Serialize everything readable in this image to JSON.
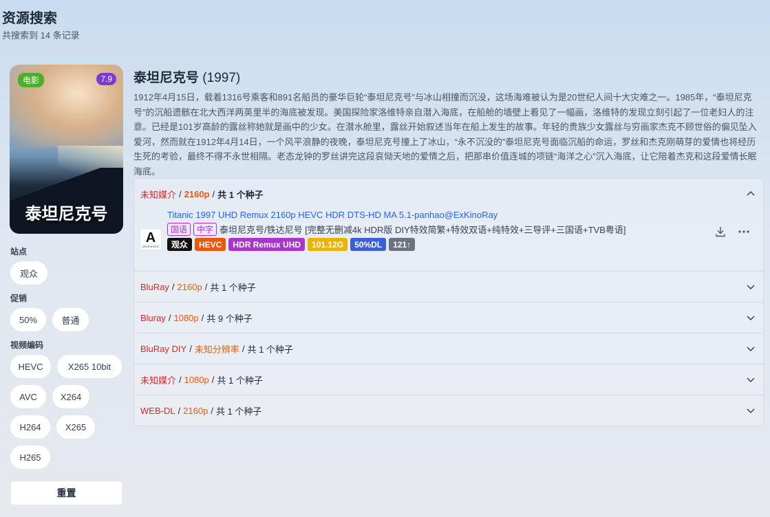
{
  "page": {
    "title": "资源搜索",
    "subtitle": "共搜索到 14 条记录"
  },
  "movie": {
    "poster_text": "泰坦尼克号",
    "type_badge": "电影",
    "rating_badge": "7.9",
    "title": "泰坦尼克号",
    "year": "(1997)",
    "overview": "1912年4月15日，载着1316号乘客和891名船员的豪华巨轮“泰坦尼克号”与冰山相撞而沉没，这场海难被认为是20世纪人间十大灾难之一。1985年，“泰坦尼克号”的沉船遗骸在北大西洋两英里半的海底被发现。美国探险家洛维特亲自潜入海底，在船舱的墙壁上看见了一幅画，洛维特的发现立刻引起了一位老妇人的注意。已经是101岁高龄的露丝称她就是画中的少女。在潜水舱里，露丝开始叙述当年在船上发生的故事。年轻的贵族少女露丝与穷画家杰克不顾世俗的偏见坠入爱河，然而就在1912年4月14日，一个风平浪静的夜晚，泰坦尼克号撞上了冰山，“永不沉没的”泰坦尼克号面临沉船的命运，罗丝和杰克刚萌芽的爱情也将经历生死的考验，最终不得不永世相隔。老态龙钟的罗丝讲完这段哀恸天地的爱情之后，把那串价值连城的项链“海洋之心”沉入海底，让它陪着杰克和这段爱情长眠海底。"
  },
  "filters": {
    "site_label": "站点",
    "sites": [
      "观众"
    ],
    "promo_label": "促销",
    "promos": [
      "50%",
      "普通"
    ],
    "codec_label": "视频编码",
    "codecs": [
      "HEVC",
      "X265 10bit",
      "AVC",
      "X264",
      "H264",
      "X265",
      "H265"
    ],
    "reset": "重置"
  },
  "groups": [
    {
      "source": "未知媒介",
      "res": "2160p",
      "count": "共 1 个种子",
      "expanded": true
    },
    {
      "source": "BluRay",
      "res": "2160p",
      "count": "共 1 个种子"
    },
    {
      "source": "Bluray",
      "res": "1080p",
      "count": "共 9 个种子"
    },
    {
      "source": "BluRay DIY",
      "res": "未知分辨率",
      "count": "共 1 个种子"
    },
    {
      "source": "未知媒介",
      "res": "1080p",
      "count": "共 1 个种子"
    },
    {
      "source": "WEB-DL",
      "res": "2160p",
      "count": "共 1 个种子"
    }
  ],
  "separator": "/",
  "torrent": {
    "logo_big": "A",
    "logo_small": "UDIENCES",
    "name": "Titanic 1997 UHD Remux 2160p HEVC HDR DTS-HD MA 5.1-panhao@ExKinoRay",
    "lang_tags": [
      "国语",
      "中字"
    ],
    "desc": "泰坦尼克号/铁达尼号 [完整无删减4k HDR版 DIY特效简繁+特效双语+纯特效+三导评+三国语+TVB粤语]",
    "tags": [
      {
        "text": "观众",
        "color": "#111111"
      },
      {
        "text": "HEVC",
        "color": "#ea580c"
      },
      {
        "text": "HDR Remux UHD",
        "color": "#a935c9"
      },
      {
        "text": "101.12G",
        "color": "#eab308"
      },
      {
        "text": "50%DL",
        "color": "#3b5fd9"
      },
      {
        "text": "121↑",
        "color": "#6b7280"
      }
    ]
  },
  "colors": {
    "source": "#dc2626",
    "resolution": "#ea580c",
    "link": "#2563eb"
  }
}
